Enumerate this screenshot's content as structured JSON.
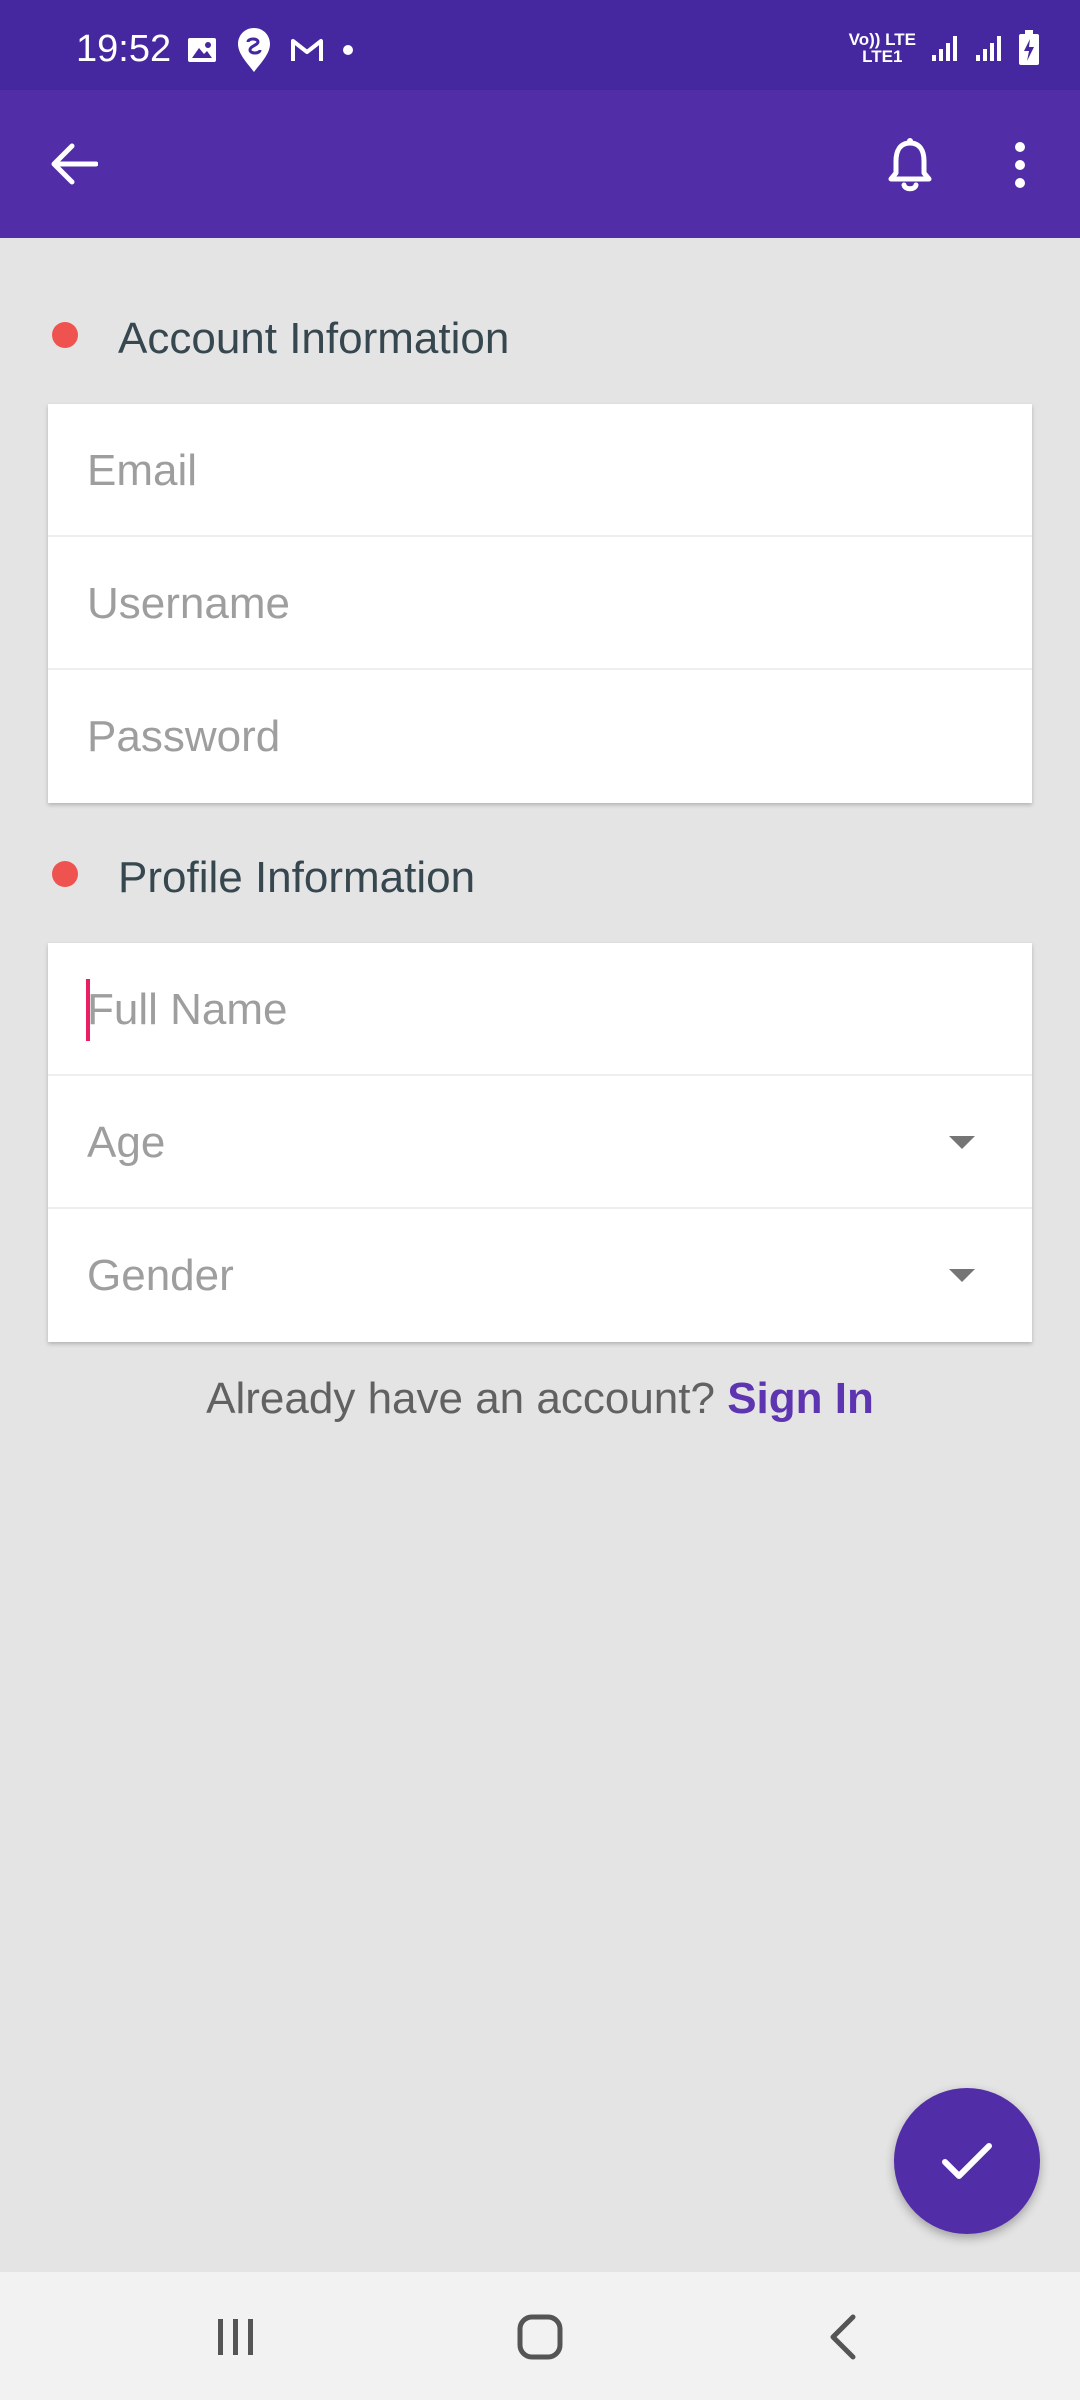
{
  "status_bar": {
    "time": "19:52",
    "network_top": "Vo)) LTE",
    "network_bottom": "LTE1",
    "icons": [
      "gallery-icon",
      "swiggy-icon",
      "gmail-icon",
      "notification-dot-icon",
      "signal-icon",
      "signal-icon",
      "battery-charging-icon"
    ]
  },
  "app_bar": {
    "back_icon": "arrow-back-icon",
    "notification_icon": "bell-icon",
    "menu_icon": "more-vertical-icon",
    "color": "#512da8"
  },
  "account_section": {
    "title": "Account Information",
    "fields": {
      "email": {
        "placeholder": "Email"
      },
      "username": {
        "placeholder": "Username"
      },
      "password": {
        "placeholder": "Password"
      }
    }
  },
  "profile_section": {
    "title": "Profile Information",
    "fields": {
      "full_name": {
        "placeholder": "Full Name"
      },
      "age": {
        "placeholder": "Age"
      },
      "gender": {
        "placeholder": "Gender"
      }
    }
  },
  "footer": {
    "prompt": "Already have an account?",
    "link": "Sign In"
  },
  "fab": {
    "icon": "check-icon"
  },
  "nav_bar": {
    "icons": [
      "recent-apps-icon",
      "home-icon",
      "back-icon"
    ]
  },
  "colors": {
    "status_bar": "#4527a0",
    "accent": "#512da8",
    "section_dot": "#ef5350",
    "caret": "#e91e63",
    "link": "#5e35b1"
  }
}
